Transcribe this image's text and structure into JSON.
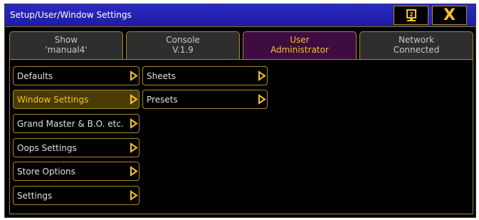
{
  "window": {
    "title": "Setup/User/Window Settings"
  },
  "title_buttons": {
    "help_icon": "help-icon",
    "close_label": "X"
  },
  "tabs": [
    {
      "label": "Show",
      "sub": "'manual4'",
      "active": false
    },
    {
      "label": "Console",
      "sub": "V.1.9",
      "active": false
    },
    {
      "label": "User",
      "sub": "Administrator",
      "active": true
    },
    {
      "label": "Network",
      "sub": "Connected",
      "active": false
    }
  ],
  "left_menu": [
    {
      "label": "Defaults",
      "selected": false
    },
    {
      "label": "Window Settings",
      "selected": true
    },
    {
      "label": "Grand Master & B.O. etc.",
      "selected": false
    },
    {
      "label": "Oops Settings",
      "selected": false
    },
    {
      "label": "Store Options",
      "selected": false
    },
    {
      "label": "Settings",
      "selected": false
    }
  ],
  "sub_menu": [
    {
      "label": "Sheets"
    },
    {
      "label": "Presets"
    }
  ],
  "colors": {
    "accent": "#f2c230",
    "titlebar": "#1d1ca4",
    "active_tab": "#3e0c40",
    "selected_item": "#4a3c00"
  }
}
